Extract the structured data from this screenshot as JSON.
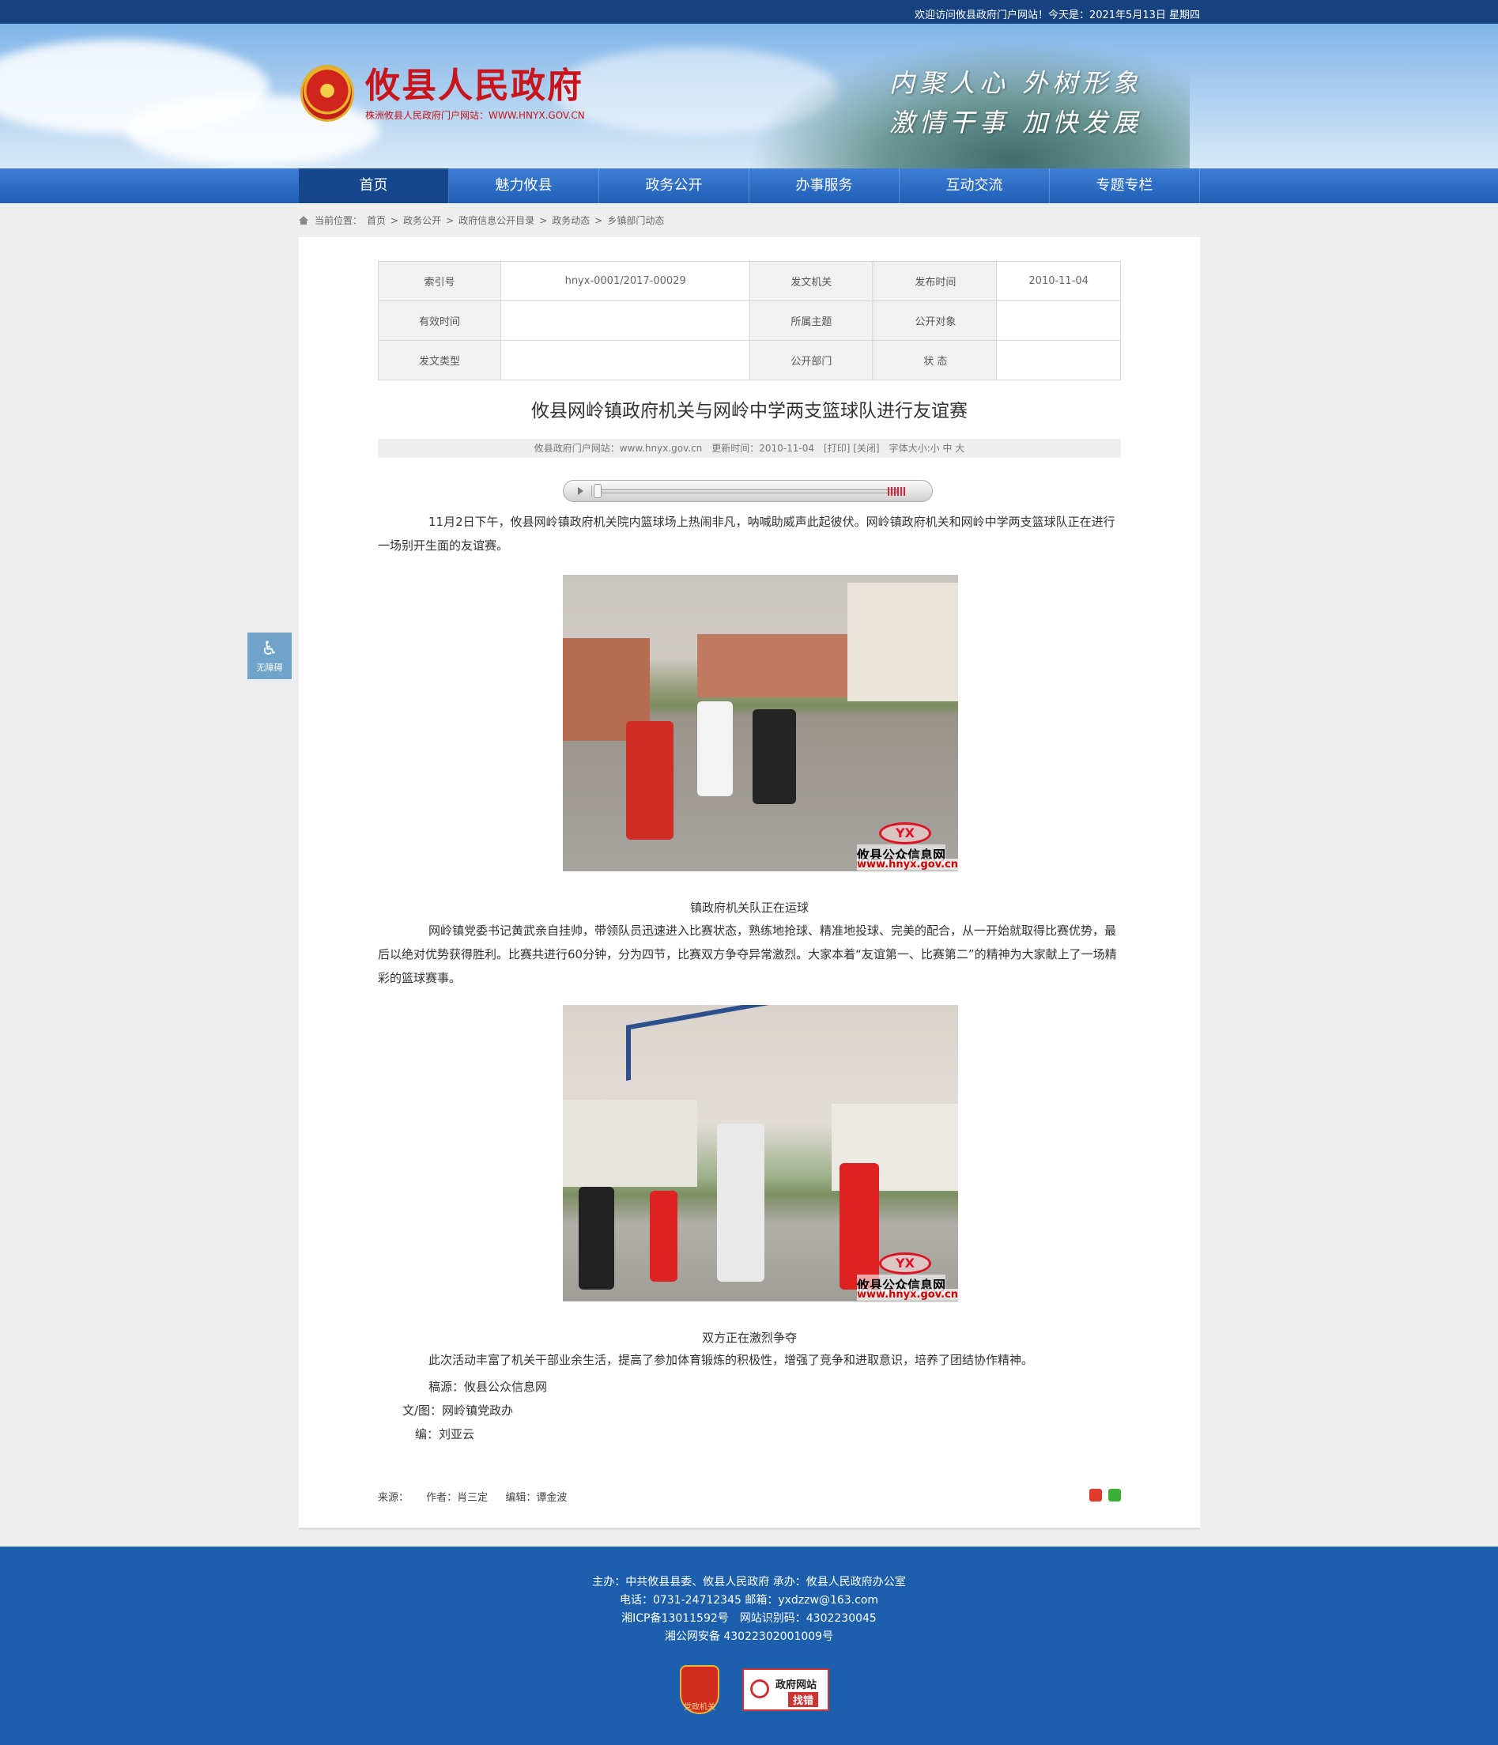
{
  "topbar": {
    "welcome": "欢迎访问攸县政府门户网站！今天是：2021年5月13日 星期四"
  },
  "header": {
    "site_title": "攸县人民政府",
    "site_subtitle": "株洲攸县人民政府门户网站：WWW.HNYX.GOV.CN",
    "slogan_line1": "内聚人心 外树形象",
    "slogan_line2": "激情干事 加快发展"
  },
  "nav": {
    "items": [
      "首页",
      "魅力攸县",
      "政务公开",
      "办事服务",
      "互动交流",
      "专题专栏"
    ],
    "active_index": 0
  },
  "breadcrumb": {
    "label": "当前位置：",
    "items": [
      "首页",
      "政务公开",
      "政府信息公开目录",
      "政务动态",
      "乡镇部门动态"
    ],
    "separator": ">"
  },
  "meta_table": {
    "rows": [
      [
        {
          "k": "索引号",
          "v": "hnyx-0001/2017-00029"
        },
        {
          "k": "发文机关",
          "v": ""
        },
        {
          "k": "发布时间",
          "v": "2010-11-04"
        }
      ],
      [
        {
          "k": "有效时间",
          "v": ""
        },
        {
          "k": "所属主题",
          "v": ""
        },
        {
          "k": "公开对象",
          "v": ""
        }
      ],
      [
        {
          "k": "发文类型",
          "v": ""
        },
        {
          "k": "公开部门",
          "v": ""
        },
        {
          "k": "状 态",
          "v": ""
        }
      ]
    ]
  },
  "article": {
    "title": "攸县网岭镇政府机关与网岭中学两支篮球队进行友谊赛",
    "info": "攸县政府门户网站：www.hnyx.gov.cn　更新时间：2010-11-04　[打印] [关闭]　字体大小:小 中 大",
    "para1": "11月2日下午，攸县网岭镇政府机关院内篮球场上热闹非凡，呐喊助威声此起彼伏。网岭镇政府机关和网岭中学两支篮球队正在进行一场别开生面的友谊赛。",
    "caption1": "镇政府机关队正在运球",
    "para2": "网岭镇党委书记黄武亲自挂帅，带领队员迅速进入比赛状态，熟练地抢球、精准地投球、完美的配合，从一开始就取得比赛优势，最后以绝对优势获得胜利。比赛共进行60分钟，分为四节，比赛双方争夺异常激烈。大家本着“友谊第一、比赛第二”的精神为大家献上了一场精彩的篮球赛事。",
    "caption2": "双方正在激烈争夺",
    "para3": "此次活动丰富了机关干部业余生活，提高了参加体育锻炼的积极性，增强了竞争和进取意识，培养了团结协作精神。",
    "source_line": "稿源：攸县公众信息网",
    "author_line": "文/图：网岭镇党政办",
    "editor_line": "编：刘亚云",
    "watermark_logo": "YX",
    "watermark_name": "攸县公众信息网",
    "watermark_url": "www.hnyx.gov.cn"
  },
  "article_footer": {
    "source": "来源：",
    "author": "作者：肖三定",
    "editor": "编辑：谭金波"
  },
  "accessibility": {
    "label": "无障碍"
  },
  "site_footer": {
    "line1": "主办：中共攸县县委、攸县人民政府 承办：攸县人民政府办公室",
    "line2": "电话：0731-24712345 邮箱：yxdzzw@163.com",
    "line3": "湘ICP备13011592号　网站识别码：4302230045",
    "line4": "湘公网安备 43022302001009号",
    "badge1": "党政机关",
    "badge2_a": "政府网站",
    "badge2_b": "找错"
  }
}
